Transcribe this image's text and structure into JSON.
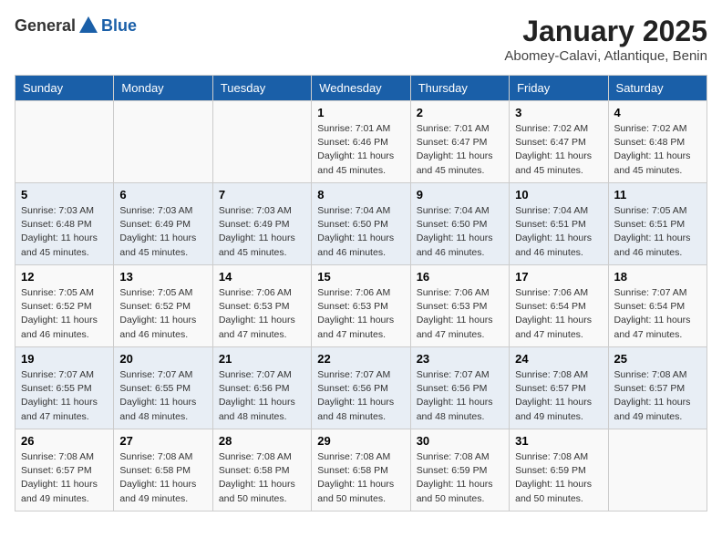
{
  "header": {
    "logo_general": "General",
    "logo_blue": "Blue",
    "month": "January 2025",
    "location": "Abomey-Calavi, Atlantique, Benin"
  },
  "weekdays": [
    "Sunday",
    "Monday",
    "Tuesday",
    "Wednesday",
    "Thursday",
    "Friday",
    "Saturday"
  ],
  "weeks": [
    [
      {
        "day": "",
        "info": ""
      },
      {
        "day": "",
        "info": ""
      },
      {
        "day": "",
        "info": ""
      },
      {
        "day": "1",
        "info": "Sunrise: 7:01 AM\nSunset: 6:46 PM\nDaylight: 11 hours and 45 minutes."
      },
      {
        "day": "2",
        "info": "Sunrise: 7:01 AM\nSunset: 6:47 PM\nDaylight: 11 hours and 45 minutes."
      },
      {
        "day": "3",
        "info": "Sunrise: 7:02 AM\nSunset: 6:47 PM\nDaylight: 11 hours and 45 minutes."
      },
      {
        "day": "4",
        "info": "Sunrise: 7:02 AM\nSunset: 6:48 PM\nDaylight: 11 hours and 45 minutes."
      }
    ],
    [
      {
        "day": "5",
        "info": "Sunrise: 7:03 AM\nSunset: 6:48 PM\nDaylight: 11 hours and 45 minutes."
      },
      {
        "day": "6",
        "info": "Sunrise: 7:03 AM\nSunset: 6:49 PM\nDaylight: 11 hours and 45 minutes."
      },
      {
        "day": "7",
        "info": "Sunrise: 7:03 AM\nSunset: 6:49 PM\nDaylight: 11 hours and 45 minutes."
      },
      {
        "day": "8",
        "info": "Sunrise: 7:04 AM\nSunset: 6:50 PM\nDaylight: 11 hours and 46 minutes."
      },
      {
        "day": "9",
        "info": "Sunrise: 7:04 AM\nSunset: 6:50 PM\nDaylight: 11 hours and 46 minutes."
      },
      {
        "day": "10",
        "info": "Sunrise: 7:04 AM\nSunset: 6:51 PM\nDaylight: 11 hours and 46 minutes."
      },
      {
        "day": "11",
        "info": "Sunrise: 7:05 AM\nSunset: 6:51 PM\nDaylight: 11 hours and 46 minutes."
      }
    ],
    [
      {
        "day": "12",
        "info": "Sunrise: 7:05 AM\nSunset: 6:52 PM\nDaylight: 11 hours and 46 minutes."
      },
      {
        "day": "13",
        "info": "Sunrise: 7:05 AM\nSunset: 6:52 PM\nDaylight: 11 hours and 46 minutes."
      },
      {
        "day": "14",
        "info": "Sunrise: 7:06 AM\nSunset: 6:53 PM\nDaylight: 11 hours and 47 minutes."
      },
      {
        "day": "15",
        "info": "Sunrise: 7:06 AM\nSunset: 6:53 PM\nDaylight: 11 hours and 47 minutes."
      },
      {
        "day": "16",
        "info": "Sunrise: 7:06 AM\nSunset: 6:53 PM\nDaylight: 11 hours and 47 minutes."
      },
      {
        "day": "17",
        "info": "Sunrise: 7:06 AM\nSunset: 6:54 PM\nDaylight: 11 hours and 47 minutes."
      },
      {
        "day": "18",
        "info": "Sunrise: 7:07 AM\nSunset: 6:54 PM\nDaylight: 11 hours and 47 minutes."
      }
    ],
    [
      {
        "day": "19",
        "info": "Sunrise: 7:07 AM\nSunset: 6:55 PM\nDaylight: 11 hours and 47 minutes."
      },
      {
        "day": "20",
        "info": "Sunrise: 7:07 AM\nSunset: 6:55 PM\nDaylight: 11 hours and 48 minutes."
      },
      {
        "day": "21",
        "info": "Sunrise: 7:07 AM\nSunset: 6:56 PM\nDaylight: 11 hours and 48 minutes."
      },
      {
        "day": "22",
        "info": "Sunrise: 7:07 AM\nSunset: 6:56 PM\nDaylight: 11 hours and 48 minutes."
      },
      {
        "day": "23",
        "info": "Sunrise: 7:07 AM\nSunset: 6:56 PM\nDaylight: 11 hours and 48 minutes."
      },
      {
        "day": "24",
        "info": "Sunrise: 7:08 AM\nSunset: 6:57 PM\nDaylight: 11 hours and 49 minutes."
      },
      {
        "day": "25",
        "info": "Sunrise: 7:08 AM\nSunset: 6:57 PM\nDaylight: 11 hours and 49 minutes."
      }
    ],
    [
      {
        "day": "26",
        "info": "Sunrise: 7:08 AM\nSunset: 6:57 PM\nDaylight: 11 hours and 49 minutes."
      },
      {
        "day": "27",
        "info": "Sunrise: 7:08 AM\nSunset: 6:58 PM\nDaylight: 11 hours and 49 minutes."
      },
      {
        "day": "28",
        "info": "Sunrise: 7:08 AM\nSunset: 6:58 PM\nDaylight: 11 hours and 50 minutes."
      },
      {
        "day": "29",
        "info": "Sunrise: 7:08 AM\nSunset: 6:58 PM\nDaylight: 11 hours and 50 minutes."
      },
      {
        "day": "30",
        "info": "Sunrise: 7:08 AM\nSunset: 6:59 PM\nDaylight: 11 hours and 50 minutes."
      },
      {
        "day": "31",
        "info": "Sunrise: 7:08 AM\nSunset: 6:59 PM\nDaylight: 11 hours and 50 minutes."
      },
      {
        "day": "",
        "info": ""
      }
    ]
  ]
}
